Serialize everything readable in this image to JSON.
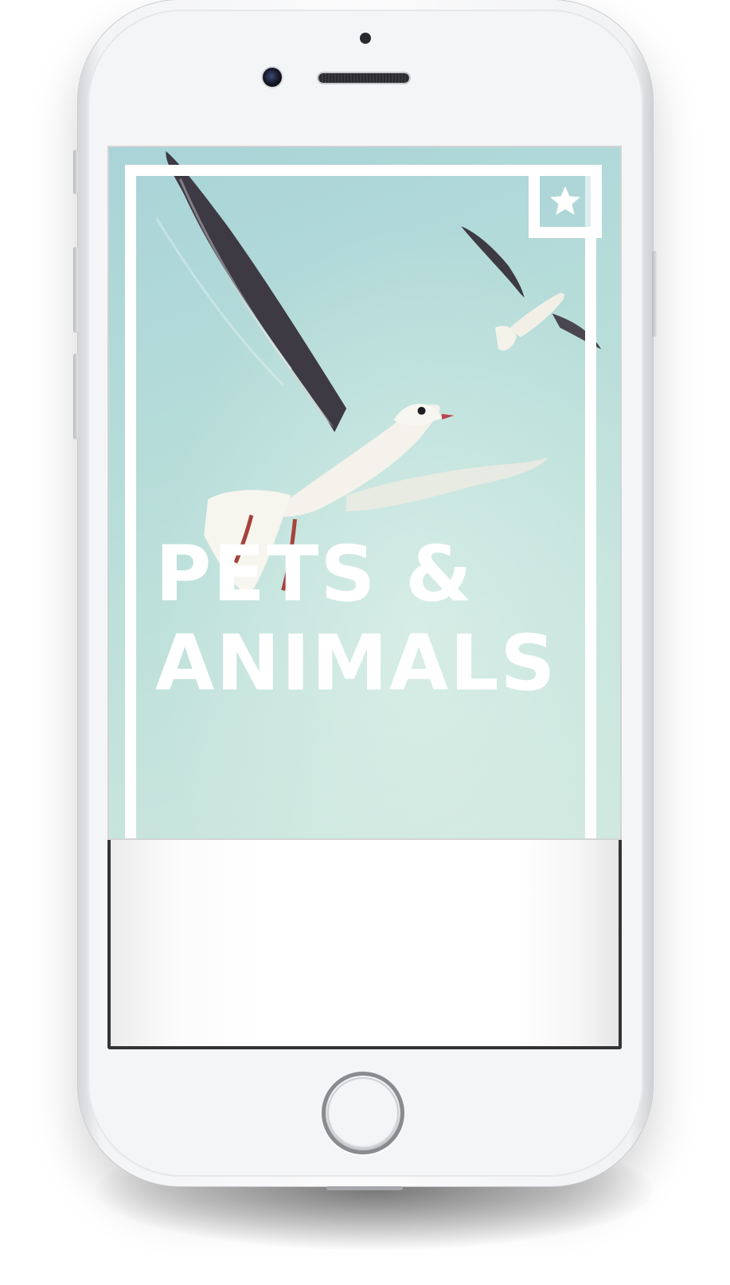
{
  "card": {
    "title_line_1": "PETS &",
    "title_line_2": "ANIMALS",
    "favorite_icon": "star-icon"
  },
  "colors": {
    "sky": "#b5dcd9",
    "frame": "#ffffff",
    "title": "#ffffff",
    "phone_body": "#f4f5f7",
    "panel_border": "#333436"
  }
}
